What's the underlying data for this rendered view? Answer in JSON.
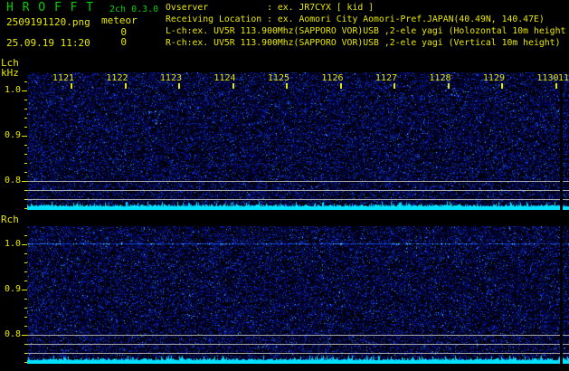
{
  "colors": {
    "background": "#000000",
    "title_green": "#00cf00",
    "text_yellow": "#e8e800",
    "noise_blue_dark": "#000060",
    "noise_blue_mid": "#1030c0",
    "noise_blue_bright": "#2060e8",
    "noise_cyan_speck": "#50c8ff",
    "noise_floor_cyan": "#00e0ff",
    "carrier_blue": "#1448e6",
    "carrier_cyan": "#64dcff",
    "reference_line_gray": "#a8a8a8"
  },
  "header": {
    "title": "H R O F F T",
    "version": "2ch 0.3.0",
    "filename": "2509191120.png",
    "mode": "meteor",
    "lch_count": "0",
    "rch_count": "0",
    "datetime": "25.09.19 11:20",
    "info_lines": [
      "Ovserver           : ex. JR7CYX [ kid ]",
      "Receiving Location : ex. Aomori City Aomori-Pref.JAPAN(40.49N, 140.47E)",
      "L-ch:ex. UV5R 113.900Mhz(SAPPORO VOR)USB ,2-ele yagi (Holozontal 10m height",
      "R-ch:ex. UV5R 113.900Mhz(SAPPORO VOR)USB ,2-ele yagi (Vertical 10m height)"
    ]
  },
  "chart_data": {
    "type": "heatmap",
    "subtype": "radio-meteor-spectrogram",
    "time_span": "11:20 - 11:30",
    "x_tick_labels": [
      "1121",
      "1122",
      "1123",
      "1124",
      "1125",
      "1126",
      "1127",
      "1128",
      "1129",
      "1130"
    ],
    "x_partial_label": "11",
    "y_unit": "kHz",
    "y_tick_labels": [
      "1.0",
      "0.9",
      "0.8"
    ],
    "y_range_khz": [
      0.736,
      1.04
    ],
    "reference_lines_khz": [
      0.8,
      0.78,
      0.76
    ],
    "panels": [
      {
        "name": "Lch",
        "axis_caption": [
          "Lch",
          "kHz"
        ],
        "content": "dense random blue noise speckle on black; no carrier line; cyan noise-floor trace along bottom edge; three gray reference lines at 0.80/0.78/0.76 kHz",
        "meteor_echo_count": 0
      },
      {
        "name": "Rch",
        "axis_caption": [
          "Rch"
        ],
        "content": "dense random blue noise speckle on black; continuous dotted blue/cyan carrier line at ~1.01 kHz; cyan noise-floor trace along bottom edge; three gray reference lines at 0.80/0.78/0.76 kHz",
        "meteor_echo_count": 0
      }
    ],
    "write_cursor": "vertical black gap near right edge (x~619) across both panels",
    "legend_position": "none",
    "grid": "off"
  }
}
